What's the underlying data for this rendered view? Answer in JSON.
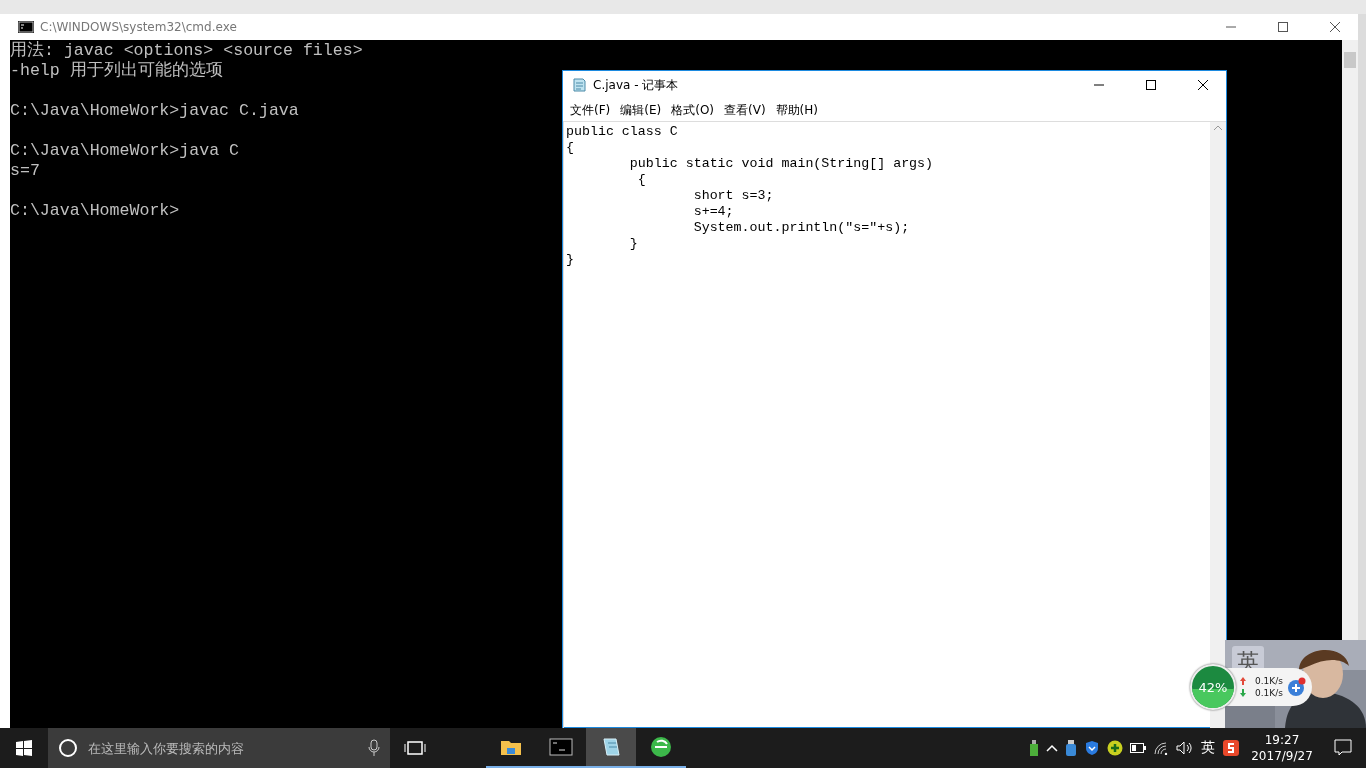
{
  "console": {
    "title": "C:\\WINDOWS\\system32\\cmd.exe",
    "blocks": [
      [
        "用法: javac <options> <source files>",
        "-help 用于列出可能的选项"
      ],
      [
        "C:\\Java\\HomeWork>javac C.java"
      ],
      [
        "C:\\Java\\HomeWork>java C",
        "s=7"
      ],
      [
        "C:\\Java\\HomeWork>"
      ]
    ]
  },
  "notepad": {
    "title": "C.java - 记事本",
    "menu": [
      "文件(F)",
      "编辑(E)",
      "格式(O)",
      "查看(V)",
      "帮助(H)"
    ],
    "code_lines": [
      "public class C",
      "{",
      "\tpublic static void main(String[] args)",
      "\t {",
      "\t\tshort s=3;",
      "\t\ts+=4;",
      "\t\tSystem.out.println(\"s=\"+s);",
      "\t}",
      "}"
    ]
  },
  "speed_widget": {
    "percent": "42%",
    "upload": "0.1K/s",
    "download": "0.1K/s",
    "ime": "英"
  },
  "taskbar": {
    "search_placeholder": "在这里输入你要搜索的内容",
    "apps": [
      {
        "kind": "folder",
        "selected": false
      },
      {
        "kind": "terminal",
        "selected": false
      },
      {
        "kind": "notepad",
        "selected": true
      },
      {
        "kind": "browser",
        "selected": false
      }
    ],
    "ime": "英",
    "time": "19:27",
    "date": "2017/9/27"
  }
}
